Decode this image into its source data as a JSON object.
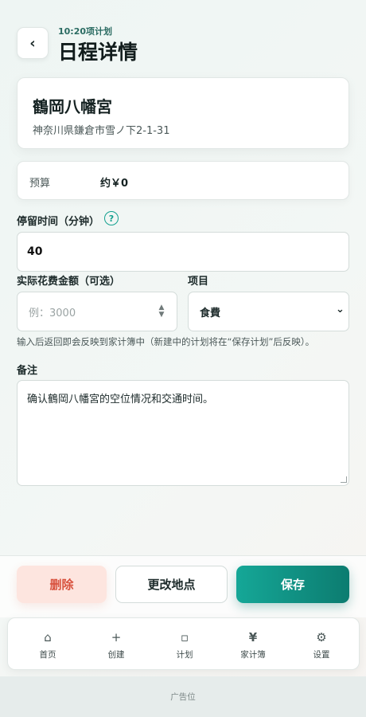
{
  "header": {
    "back_icon": "‹",
    "subtitle": "10:20项计划",
    "title": "日程详情"
  },
  "place": {
    "name": "鶴岡八幡宮",
    "address": "神奈川県鎌倉市雪ノ下2-1-31"
  },
  "budget": {
    "label": "预算",
    "value": "约￥0"
  },
  "stay": {
    "label": "停留时间（分钟）",
    "help_icon": "?",
    "value": "40"
  },
  "cost": {
    "label": "实际花费金额（可选）",
    "placeholder": "例：3000"
  },
  "category": {
    "label": "项目",
    "selected": "食費",
    "chevron": "⌄"
  },
  "hint": "输入后返回即会反映到家计簿中（新建中的计划将在“保存计划”后反映）。",
  "notes": {
    "label": "备注",
    "value": "确认鶴岡八幡宮的空位情况和交通时间。"
  },
  "actions": {
    "delete": "删除",
    "change_location": "更改地点",
    "save": "保存"
  },
  "nav": {
    "items": [
      {
        "icon": "⌂",
        "label": "首页"
      },
      {
        "icon": "+",
        "label": "创建"
      },
      {
        "icon": "▫",
        "label": "计划"
      },
      {
        "icon": "¥",
        "label": "家计簿"
      },
      {
        "icon": "⚙",
        "label": "设置"
      }
    ]
  },
  "ad": {
    "label": "广告位"
  },
  "colors": {
    "accent": "#14a08f",
    "save_start": "#15a797",
    "save_end": "#0c7c70",
    "delete_bg": "#fde5df",
    "delete_text": "#d8513d"
  }
}
